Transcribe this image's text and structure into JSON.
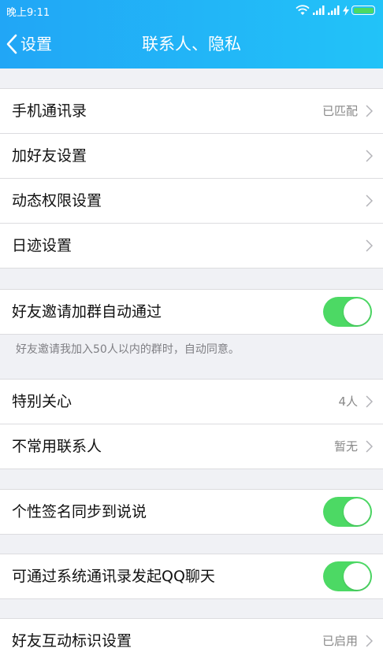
{
  "status_bar": {
    "time": "晚上9:11"
  },
  "nav": {
    "back_label": "设置",
    "title": "联系人、隐私"
  },
  "rows": {
    "contacts": {
      "label": "手机通讯录",
      "value": "已匹配"
    },
    "add_friend": {
      "label": "加好友设置"
    },
    "moments_permission": {
      "label": "动态权限设置"
    },
    "footprint": {
      "label": "日迹设置"
    },
    "auto_group_invite": {
      "label": "好友邀请加群自动通过",
      "enabled": true
    },
    "special_care": {
      "label": "特别关心",
      "value": "4人"
    },
    "infrequent_contacts": {
      "label": "不常用联系人",
      "value": "暂无"
    },
    "signature_sync": {
      "label": "个性签名同步到说说",
      "enabled": true
    },
    "system_contacts_chat": {
      "label": "可通过系统通讯录发起QQ聊天",
      "enabled": true
    },
    "interaction_mark": {
      "label": "好友互动标识设置",
      "value": "已启用"
    }
  },
  "hints": {
    "auto_group_invite": "好友邀请我加入50人以内的群时，自动同意。"
  },
  "colors": {
    "header_gradient_start": "#21a6f6",
    "header_gradient_end": "#22c3f8",
    "toggle_on": "#4cd964",
    "background": "#f0f1f5"
  }
}
